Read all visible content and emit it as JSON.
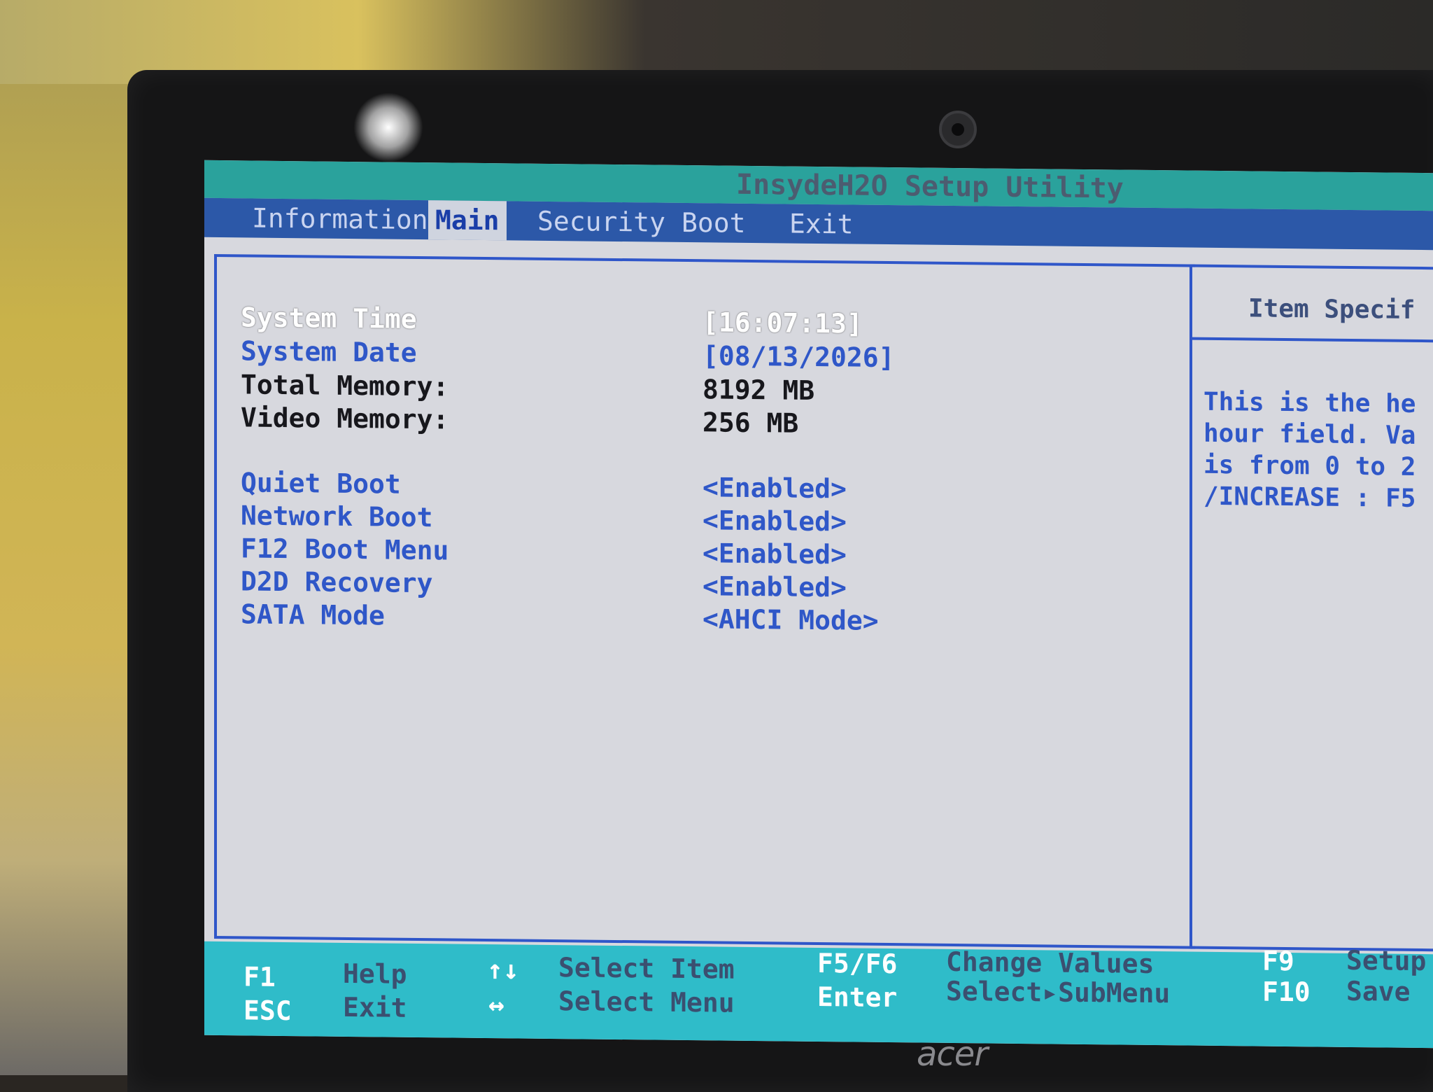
{
  "title": "InsydeH2O Setup Utility",
  "menu": {
    "tabs": [
      {
        "label": "Information"
      },
      {
        "label": "Main"
      },
      {
        "label": "Security"
      },
      {
        "label": "Boot"
      },
      {
        "label": "Exit"
      }
    ],
    "active": "Main"
  },
  "main": {
    "items": [
      {
        "label": "System Time",
        "value": "[16:07:13]"
      },
      {
        "label": "System Date",
        "value": "[08/13/2026]"
      },
      {
        "label": "Total Memory:",
        "value": "8192 MB"
      },
      {
        "label": "Video Memory:",
        "value": "256 MB"
      },
      {
        "label": "Quiet Boot",
        "value": "<Enabled>"
      },
      {
        "label": "Network Boot",
        "value": "<Enabled>"
      },
      {
        "label": "F12 Boot Menu",
        "value": "<Enabled>"
      },
      {
        "label": "D2D Recovery",
        "value": "<Enabled>"
      },
      {
        "label": "SATA Mode",
        "value": "<AHCI Mode>"
      }
    ]
  },
  "help": {
    "title": "Item Specif",
    "text": "This is the he\nhour field. Va\nis from 0 to 2\n/INCREASE : F5"
  },
  "status": {
    "f1_key": "F1",
    "f1_desc": "Help",
    "esc_key": "ESC",
    "esc_desc": "Exit",
    "updown_key": "↑↓",
    "updown_desc": "Select Item",
    "leftright_key": "↔",
    "leftright_desc": "Select Menu",
    "f5f6_key": "F5/F6",
    "f5f6_desc": "Change Values",
    "enter_key": "Enter",
    "enter_desc": "Select▸SubMenu",
    "f9_key": "F9",
    "f9_desc": "Setup",
    "f10_key": "F10",
    "f10_desc": "Save"
  },
  "brand": "acer"
}
